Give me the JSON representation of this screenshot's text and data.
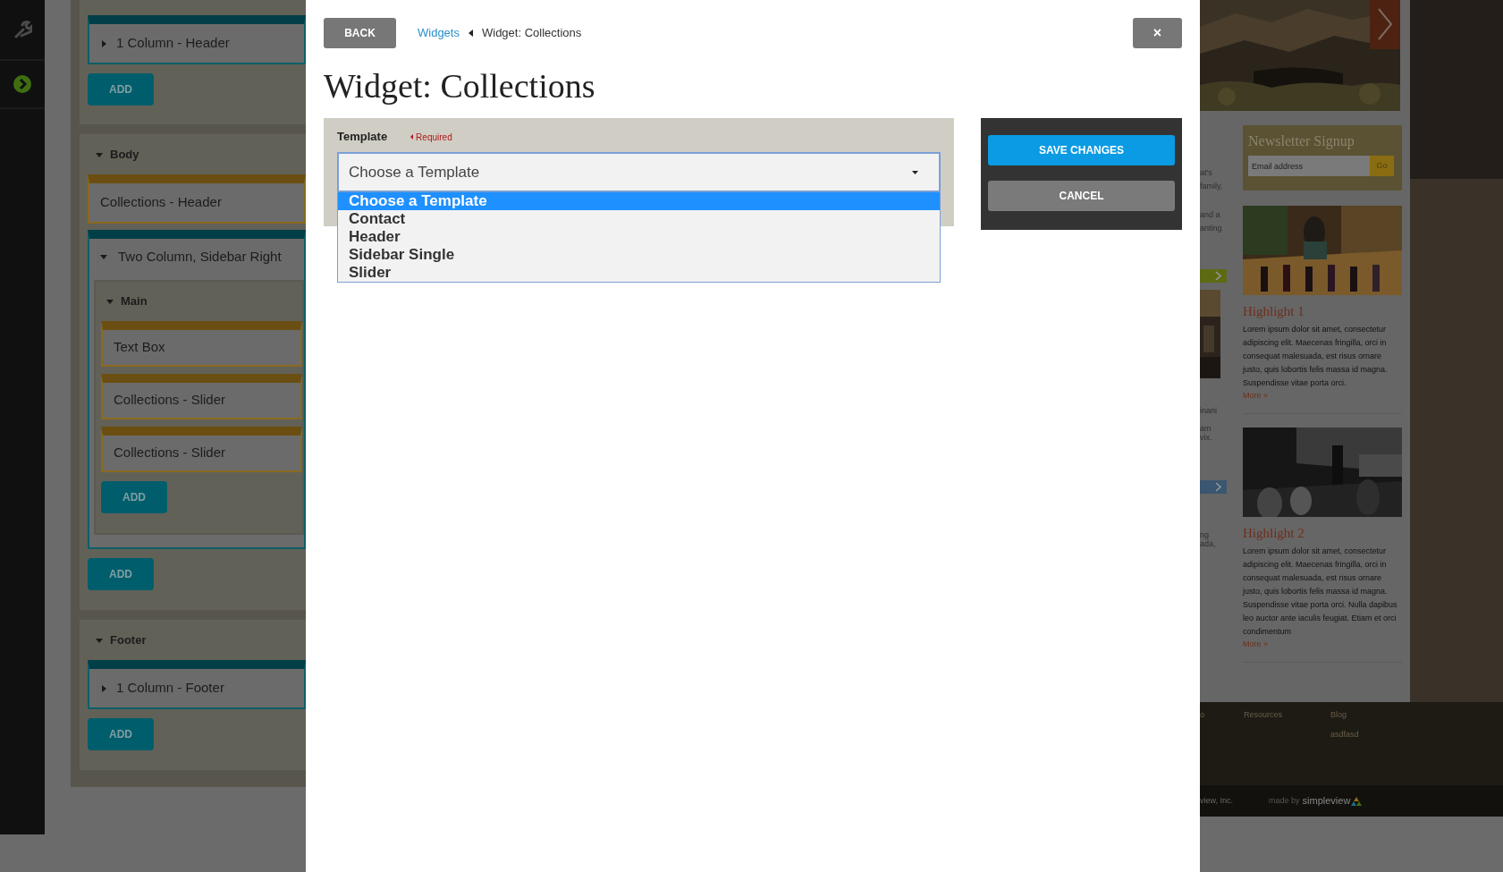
{
  "builder": {
    "sections": [
      {
        "items": [
          {
            "kind": "layout",
            "label": "1 Column - Header",
            "expanded": false
          }
        ],
        "add": "ADD"
      },
      {
        "title": "Body",
        "expanded": true,
        "items": [
          {
            "kind": "widget",
            "label": "Collections - Header"
          },
          {
            "kind": "layout",
            "label": "Two Column, Sidebar Right",
            "expanded": true,
            "regions": [
              {
                "title": "Main",
                "expanded": true,
                "items": [
                  {
                    "kind": "widget",
                    "label": "Text Box"
                  },
                  {
                    "kind": "widget",
                    "label": "Collections - Slider"
                  },
                  {
                    "kind": "widget",
                    "label": "Collections - Slider"
                  }
                ],
                "add": "ADD"
              }
            ]
          }
        ],
        "add": "ADD"
      },
      {
        "title": "Footer",
        "expanded": true,
        "items": [
          {
            "kind": "layout",
            "label": "1 Column - Footer",
            "expanded": false
          }
        ],
        "add": "ADD"
      }
    ]
  },
  "modal": {
    "back": "BACK",
    "breadcrumb": [
      {
        "kind": "link",
        "label": "Widgets"
      },
      {
        "kind": "current",
        "label": "Widget: Collections"
      }
    ],
    "close": "×",
    "title": "Widget: Collections",
    "form": {
      "label": "Template",
      "required": "Required",
      "select": {
        "value": "Choose a Template",
        "expanded": true,
        "options": [
          {
            "label": "Choose a Template",
            "selected": true
          },
          {
            "label": "Contact",
            "selected": false
          },
          {
            "label": "Header",
            "selected": false
          },
          {
            "label": "Sidebar Single",
            "selected": false
          },
          {
            "label": "Slider",
            "selected": false
          }
        ]
      }
    },
    "actions": {
      "save": "SAVE CHANGES",
      "cancel": "CANCEL"
    }
  },
  "site": {
    "fragments": [
      "at's",
      "family,",
      "and a",
      "anting",
      "inani",
      "am",
      "vix.",
      "ng",
      "ada,"
    ],
    "newsletter": {
      "title": "Newsletter Signup",
      "placeholder": "Email address",
      "button": "Go"
    },
    "highlights": [
      {
        "title": "Highlight 1",
        "text": "Lorem ipsum dolor sit amet, consectetur adipiscing elit. Maecenas fringilla, orci in consequat malesuada, est risus ornare justo, quis lobortis felis massa id magna. Suspendisse vitae porta orci.",
        "more": "More »"
      },
      {
        "title": "Highlight 2",
        "text": "Lorem ipsum dolor sit amet, consectetur adipiscing elit. Maecenas fringilla, orci in consequat malesuada, est risus ornare justo, quis lobortis felis massa id magna. Suspendisse vitae porta orci. Nulla dapibus leo auctor ante iaculis feugiat. Etiam et orci condimentum",
        "more": "More »"
      }
    ],
    "footer": {
      "links": [
        "o",
        "Resources",
        "Blog"
      ],
      "sublinks": [
        "asdfasd"
      ],
      "copyright": "view, Inc.",
      "made_by": "made by",
      "brand": "simpleview"
    }
  }
}
